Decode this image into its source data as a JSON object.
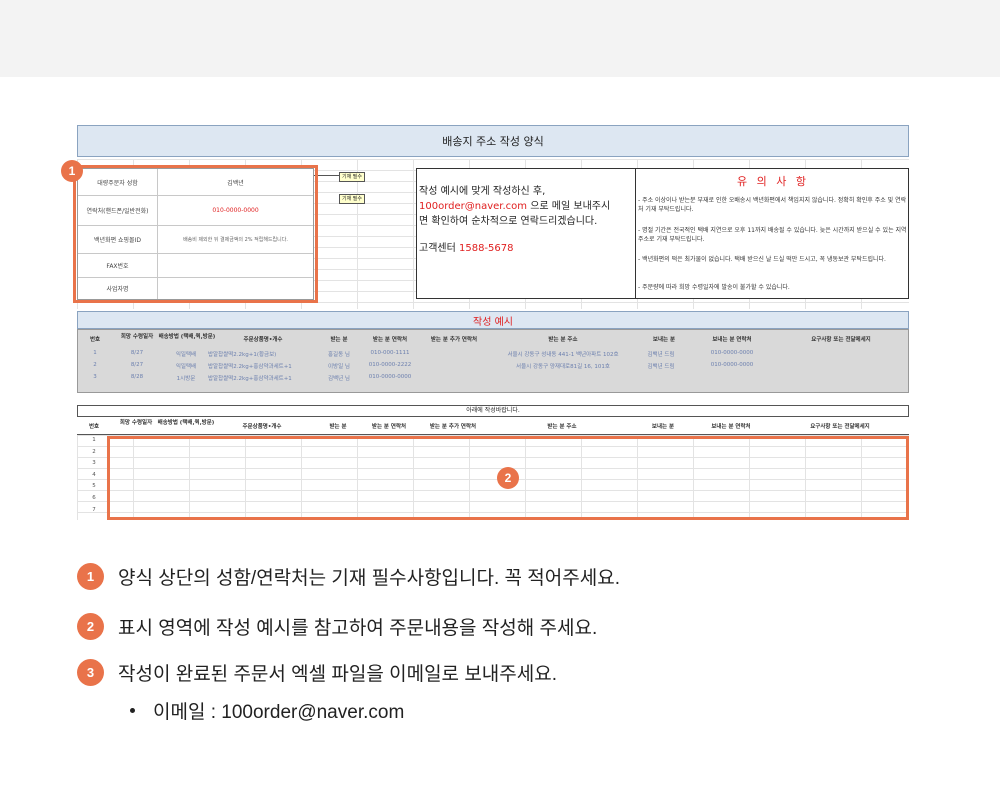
{
  "form": {
    "title": "배송지 주소 작성 양식",
    "orderer_fields": [
      {
        "label": "대량주문자 성함",
        "value": "김백년",
        "value_color": "#444444"
      },
      {
        "label": "연락처(핸드폰/일반전화)",
        "value": "010-0000-0000",
        "value_color": "#e02020"
      },
      {
        "label": "백년화편 쇼핑몰ID",
        "value": "배송비 제외한 뒤 결제금액의 2% 적립해드립니다.",
        "value_color": "#666666"
      },
      {
        "label": "FAX번호",
        "value": "",
        "value_color": "#444444"
      },
      {
        "label": "사업자명",
        "value": "",
        "value_color": "#444444"
      }
    ],
    "required_notes": [
      "기재 필수",
      "기재 필수"
    ],
    "guide": {
      "line1": "작성 예시에 맞게 작성하신 후,",
      "email": "100order@naver.com",
      "line2": " 으로 메일 보내주시",
      "line3": "면 확인하여 순차적으로 연락드리겠습니다.",
      "center_label": "고객센터 ",
      "center_phone": "1588-5678"
    },
    "caution": {
      "title": "유 의 사 항",
      "items": [
        "- 주소 이상이나 받는분 부재로 인한 오배송시 백년화편에서 책임지지 않습니다.   정확히 확인후 주소 및 연락처 기재 부탁드립니다.",
        "- 명절 기간은 전국적인 택배 지연으로 오후 11까지 배송될 수 있습니다. 늦은 시간까지 받으실 수 있는 지역 주소로 기재 부탁드립니다.",
        "- 백년화편의 떡은 최가물이 없습니다. 택배 받으신 날 드실 떡만 드시고, 꼭 냉동보관 부탁드립니다.",
        "- 주문량에 따라 희망 수령일자에 발송이 불가할 수 있습니다."
      ]
    },
    "example": {
      "title": "작성 예시",
      "headers": [
        "번호",
        "희망 수령일자",
        "배송방법 (택배,퀵,방문)",
        "주문상품명•개수",
        "받는 분",
        "받는 분 연락처",
        "받는 분 추가 연락처",
        "받는 분 주소",
        "보내는 분",
        "보내는 분 연락처",
        "요구사항 또는 전달메세지"
      ],
      "rows": [
        [
          "1",
          "8/27",
          "익일택배",
          "밥알찹쌀떡2.2kg+1(황금보)",
          "홍길동 님",
          "010-000-1111",
          "",
          "서울시 강동구 성내동 441-1 백년아파트 102호",
          "김백년 드림",
          "010-0000-0000",
          ""
        ],
        [
          "2",
          "8/27",
          "익일택배",
          "밥알찹쌀떡2.2kg+홍삼약과세트+1",
          "이방일 님",
          "010-0000-2222",
          "",
          "서울시 강동구 양재대로81길 16, 101호",
          "김백년 드림",
          "010-0000-0000",
          ""
        ],
        [
          "3",
          "8/28",
          "1시방문",
          "밥알찹쌀떡2.2kg+홍삼약과세트+1",
          "김백년 님",
          "010-0000-0000",
          "",
          "",
          "",
          "",
          ""
        ]
      ]
    },
    "entry": {
      "title": "아래에 작성바랍니다.",
      "headers": [
        "번호",
        "희망 수령일자",
        "배송방법 (택배,퀵,방문)",
        "주문상품명•개수",
        "받는 분",
        "받는 분 연락처",
        "받는 분 추가 연락처",
        "받는 분 주소",
        "보내는 분",
        "보내는 분 연락처",
        "요구사항 또는 전달메세지"
      ],
      "row_numbers": [
        "1",
        "2",
        "3",
        "4",
        "5",
        "6",
        "7"
      ]
    },
    "badges": [
      "1",
      "2"
    ]
  },
  "instructions": [
    {
      "num": "1",
      "text": "양식 상단의 성함/연락처는 기재 필수사항입니다. 꼭 적어주세요."
    },
    {
      "num": "2",
      "text": "표시 영역에 작성 예시를 참고하여 주문내용을 작성해 주세요."
    },
    {
      "num": "3",
      "text": "작성이 완료된 주문서 엑셀 파일을 이메일로 보내주세요."
    }
  ],
  "email_bullet": "이메일 : 100order@naver.com",
  "colors": {
    "accent": "#e9734a",
    "header_blue": "#dde7f2",
    "red": "#e02020",
    "example_bg": "#d9d9d9"
  }
}
